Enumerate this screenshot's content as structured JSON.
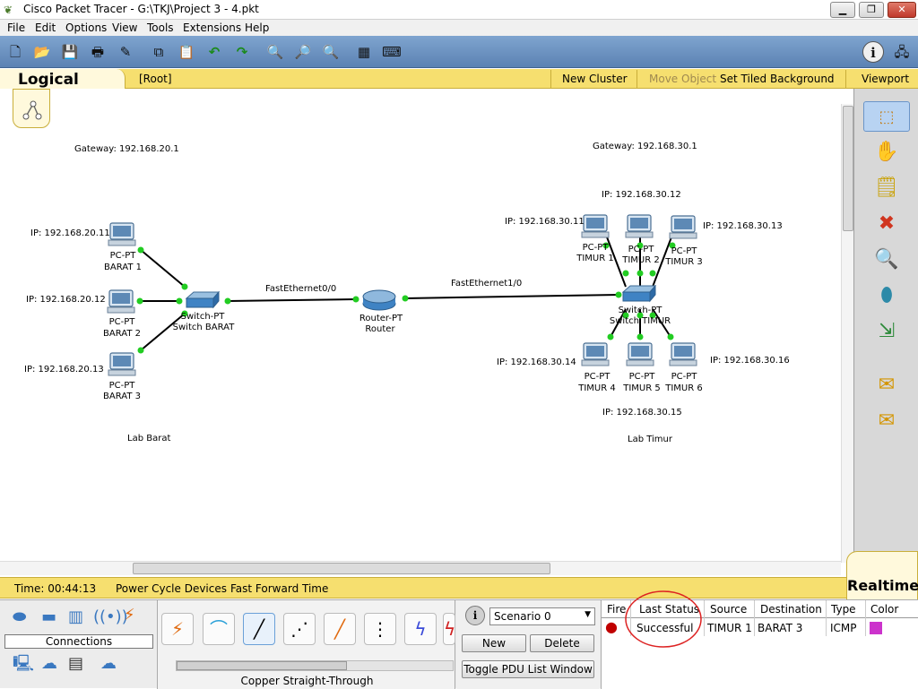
{
  "window": {
    "title": "Cisco Packet Tracer - G:\\TKJ\\Project 3 - 4.pkt",
    "minimize": "▁",
    "maximize": "❐",
    "close": "✕"
  },
  "menu": [
    "File",
    "Edit",
    "Options",
    "View",
    "Tools",
    "Extensions",
    "Help"
  ],
  "toolbar": {
    "tools": [
      "new-file",
      "open-folder",
      "save",
      "print",
      "activity-wizard",
      "copy",
      "paste",
      "undo",
      "redo",
      "zoom-in",
      "zoom-reset",
      "zoom-out",
      "palette",
      "custom-device"
    ],
    "info": "i"
  },
  "workspace_bar": {
    "tab": "Logical",
    "root": "[Root]",
    "new_cluster": "New Cluster",
    "move_object": "Move Object",
    "set_tiled_background": "Set Tiled Background",
    "viewport": "Viewport"
  },
  "topology": {
    "labels": {
      "gw_barat": "Gateway: 192.168.20.1",
      "gw_timur": "Gateway: 192.168.30.1",
      "lab_barat": "Lab Barat",
      "lab_timur": "Lab Timur",
      "link_fe00": "FastEthernet0/0",
      "link_fe10": "FastEthernet1/0"
    },
    "devices": {
      "barat1": {
        "type": "PC-PT",
        "name": "BARAT 1",
        "ip": "IP: 192.168.20.11"
      },
      "barat2": {
        "type": "PC-PT",
        "name": "BARAT 2",
        "ip": "IP: 192.168.20.12"
      },
      "barat3": {
        "type": "PC-PT",
        "name": "BARAT 3",
        "ip": "IP: 192.168.20.13"
      },
      "switch_barat": {
        "type": "Switch-PT",
        "name": "Switch BARAT"
      },
      "router": {
        "type": "Router-PT",
        "name": "Router"
      },
      "switch_timur": {
        "type": "Switch-PT",
        "name": "Switch TIMUR"
      },
      "timur1": {
        "type": "PC-PT",
        "name": "TIMUR 1",
        "ip": "IP: 192.168.30.11"
      },
      "timur2": {
        "type": "PC-PT",
        "name": "TIMUR 2",
        "ip": "IP: 192.168.30.12"
      },
      "timur3": {
        "type": "PC-PT",
        "name": "TIMUR 3",
        "ip": "IP: 192.168.30.13"
      },
      "timur4": {
        "type": "PC-PT",
        "name": "TIMUR 4",
        "ip": "IP: 192.168.30.14"
      },
      "timur5": {
        "type": "PC-PT",
        "name": "TIMUR 5",
        "ip": "IP: 192.168.30.15"
      },
      "timur6": {
        "type": "PC-PT",
        "name": "TIMUR 6",
        "ip": "IP: 192.168.30.16"
      }
    },
    "link_color": "#000000",
    "port_color": "#22cc22"
  },
  "right_tools": [
    "select-tool",
    "hand-tool",
    "note-tool",
    "delete-tool",
    "inspect-tool",
    "draw-shape-tool",
    "resize-tool",
    "add-simple-pdu",
    "add-complex-pdu"
  ],
  "status_bar": {
    "time": "Time: 00:44:13",
    "power_cycle": "Power Cycle Devices",
    "fast_forward": "Fast Forward Time",
    "mode": "Realtime"
  },
  "bottom": {
    "connections_label": "Connections",
    "cable_selected_name": "Copper Straight-Through",
    "cables": [
      "automatic-cable",
      "console-cable",
      "copper-straight-through",
      "copper-cross-over",
      "fiber-cable",
      "phone-cable",
      "coaxial-cable",
      "serial-dce-cable"
    ],
    "scenario": {
      "info": "i",
      "selected": "Scenario 0",
      "new": "New",
      "delete": "Delete",
      "toggle": "Toggle PDU List Window"
    },
    "pdu_table": {
      "headers": [
        "Fire",
        "Last Status",
        "Source",
        "Destination",
        "Type",
        "Color"
      ],
      "rows": [
        {
          "fire": "●",
          "last_status": "Successful",
          "source": "TIMUR 1",
          "destination": "BARAT 3",
          "type": "ICMP",
          "color": "#cc33cc"
        }
      ]
    }
  }
}
